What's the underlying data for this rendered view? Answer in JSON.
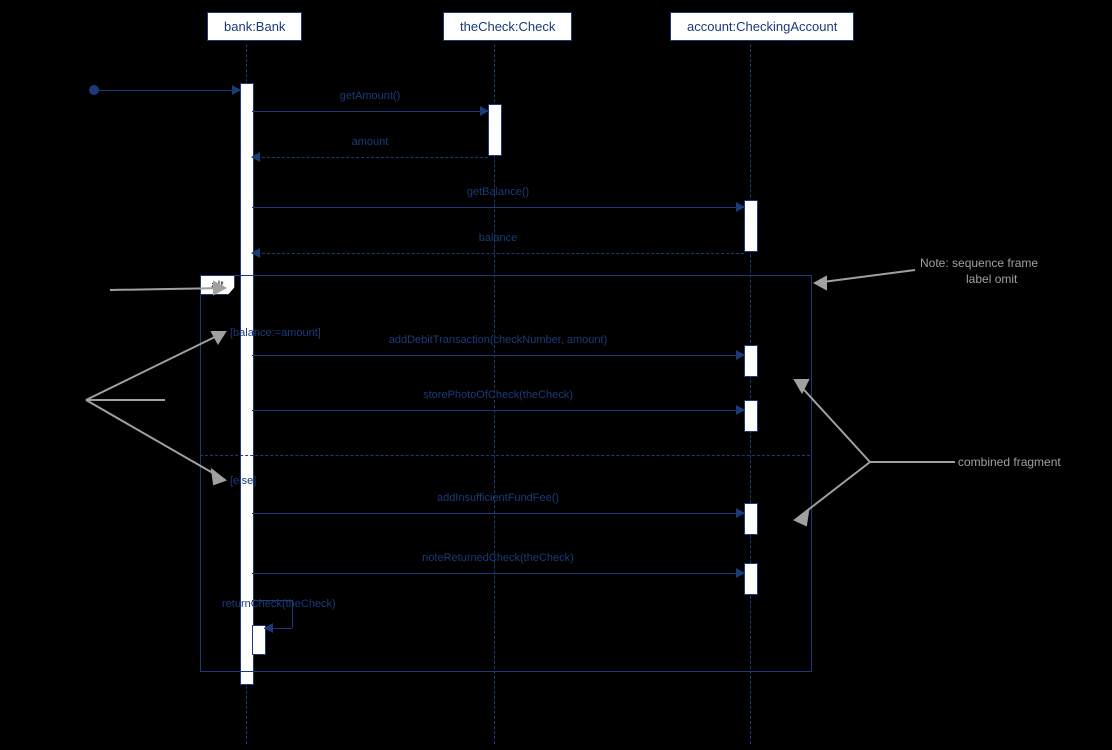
{
  "participants": {
    "bank": "bank:Bank",
    "check": "theCheck:Check",
    "account": "account:CheckingAccount"
  },
  "frag": {
    "label": "alt",
    "guard1": "[balance:=amount]",
    "guard2": "[else]"
  },
  "msgs": {
    "found": "",
    "m1": "getAmount()",
    "r1": "amount",
    "m2": "getBalance()",
    "r2": "balance",
    "m3": "addDebitTransaction(checkNumber, amount)",
    "m4": "storePhotoOfCheck(theCheck)",
    "m5": "addInsufficientFundFee()",
    "m6": "noteReturnedCheck(theCheck)",
    "m7": "returnCheck(theCheck)"
  },
  "notes": {
    "n1": "Note: sequence frame",
    "n1b": "label omit",
    "n2": "combined fragment"
  }
}
